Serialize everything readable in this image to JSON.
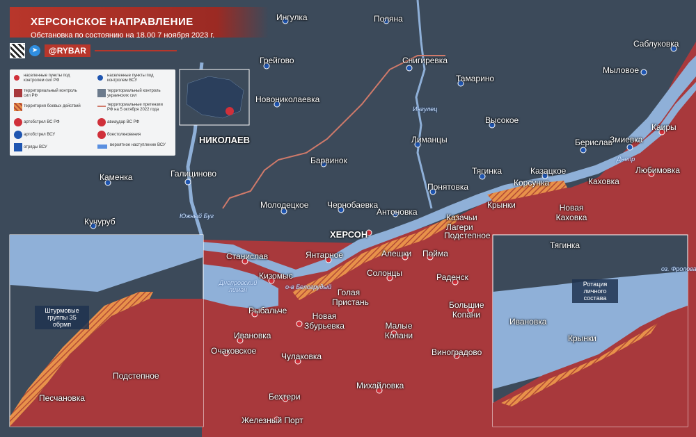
{
  "header": {
    "title": "ХЕРСОНСКОЕ НАПРАВЛЕНИЕ",
    "subtitle": "Обстановка по состоянию на 18.00 7 ноября 2023 г.",
    "brand": "@RYBAR",
    "telegram_icon": "telegram-icon",
    "qr_icon": "qr-code-icon"
  },
  "legend": {
    "items": [
      {
        "label": "населенные пункты под контролем сил РФ",
        "icon": "red-settlement-icon"
      },
      {
        "label": "населенные пункты под контролем ВСУ",
        "icon": "blue-settlement-icon"
      },
      {
        "label": "территориальный контроль сил РФ",
        "icon": "red-territory-icon"
      },
      {
        "label": "территориальный контроль украинских сил",
        "icon": "grey-territory-icon"
      },
      {
        "label": "территория боевых действий",
        "icon": "combat-zone-icon"
      },
      {
        "label": "территориальные претензии РФ на 5 октября 2022 года",
        "icon": "claims-line-icon"
      },
      {
        "label": "артобстрел ВС РФ",
        "icon": "ru-artillery-icon"
      },
      {
        "label": "авиаудар ВС РФ",
        "icon": "ru-airstrike-icon"
      },
      {
        "label": "артобстрел ВСУ",
        "icon": "ua-artillery-icon"
      },
      {
        "label": "боестолкновения",
        "icon": "clash-icon"
      },
      {
        "label": "отряды ВСУ",
        "icon": "ua-units-icon"
      },
      {
        "label": "вероятное наступление ВСУ",
        "icon": "ua-advance-arrow-icon"
      }
    ]
  },
  "colors": {
    "ru_control": "#a8393c",
    "ua_territory": "#3c4a5a",
    "water": "#8fb0d8",
    "combat_zone": "#e8914a",
    "claims_line": "#d07a6a",
    "ua_blue": "#1f55b0",
    "ru_red": "#d0303a",
    "brand_red": "#b8362b"
  },
  "places": {
    "ingulka": "Ингулка",
    "polyana": "Поляна",
    "saблуkovka": "Саблуковка",
    "greygovo": "Грейгово",
    "snigirevka": "Снигиревка",
    "mylovoe": "Мыловое",
    "tamarino": "Тамарино",
    "novonikolaevka": "Новониколаевка",
    "ingulets": "Ингулец",
    "vysokoe": "Высокое",
    "kairy": "Каиры",
    "nikolaev": "НИКОЛАЕВ",
    "beryslav": "Берислав",
    "zmievka": "Змиевка",
    "limantsy": "Лиманцы",
    "barvinok": "Барвинок",
    "tyaginka": "Тягинка",
    "kazatskoe": "Казацкое",
    "lyubimovka": "Любимовка",
    "dnepr": "Днепр",
    "kakhovka": "Каховка",
    "kamenka": "Каменка",
    "galitsinovo": "Галициново",
    "ponyatovka": "Понятовка",
    "korsunka": "Корсунка",
    "krynki": "Крынки",
    "nova_kakhovka": "Новая Каховка",
    "yuzhny_bug": "Южный Буг",
    "molodetskoe": "Молодецкое",
    "chernobaevka": "Чернобаевка",
    "antonovka": "Антоновка",
    "kutsurub": "Кучуруб",
    "kherson": "ХЕРСОН",
    "kazachi_lageri": "Казачьи Лагери",
    "podstepnoe": "Подстепное",
    "stanislav": "Станислав",
    "yantarnoe": "Янтарное",
    "aleshki": "Алешки",
    "poyma": "Пойма",
    "kizomys": "Кизомыс",
    "dneprovsky_liman": "Днепровский лиман",
    "belogrudy": "о-в Белогрудый",
    "solontsy": "Солонцы",
    "radensk": "Раденск",
    "golaya_pristan": "Голая Пристань",
    "rybalche": "Рыбальче",
    "novaya_zbur": "Новая Збурьевка",
    "bolshie_kopani": "Большие Копани",
    "ivanovka": "Ивановка",
    "malye_kopani": "Малые Копани",
    "ochakovskoe": "Очаковское",
    "chulakovka": "Чулаковка",
    "vinogradovo": "Виноградово",
    "mikhaylovka": "Михайловка",
    "bekhteri": "Бехтери",
    "zhelezny_port": "Железный Порт"
  },
  "inset_left": {
    "assault": "Штурмовые группы 35 обрмп",
    "podstepnoe": "Подстепное",
    "peschanovka": "Песчановка"
  },
  "inset_right": {
    "tyaginka": "Тягинка",
    "frolova": "оз. Фролова",
    "rotation": "Ротация личного состава",
    "ivanovka": "Ивановка",
    "krynki": "Крынки"
  }
}
